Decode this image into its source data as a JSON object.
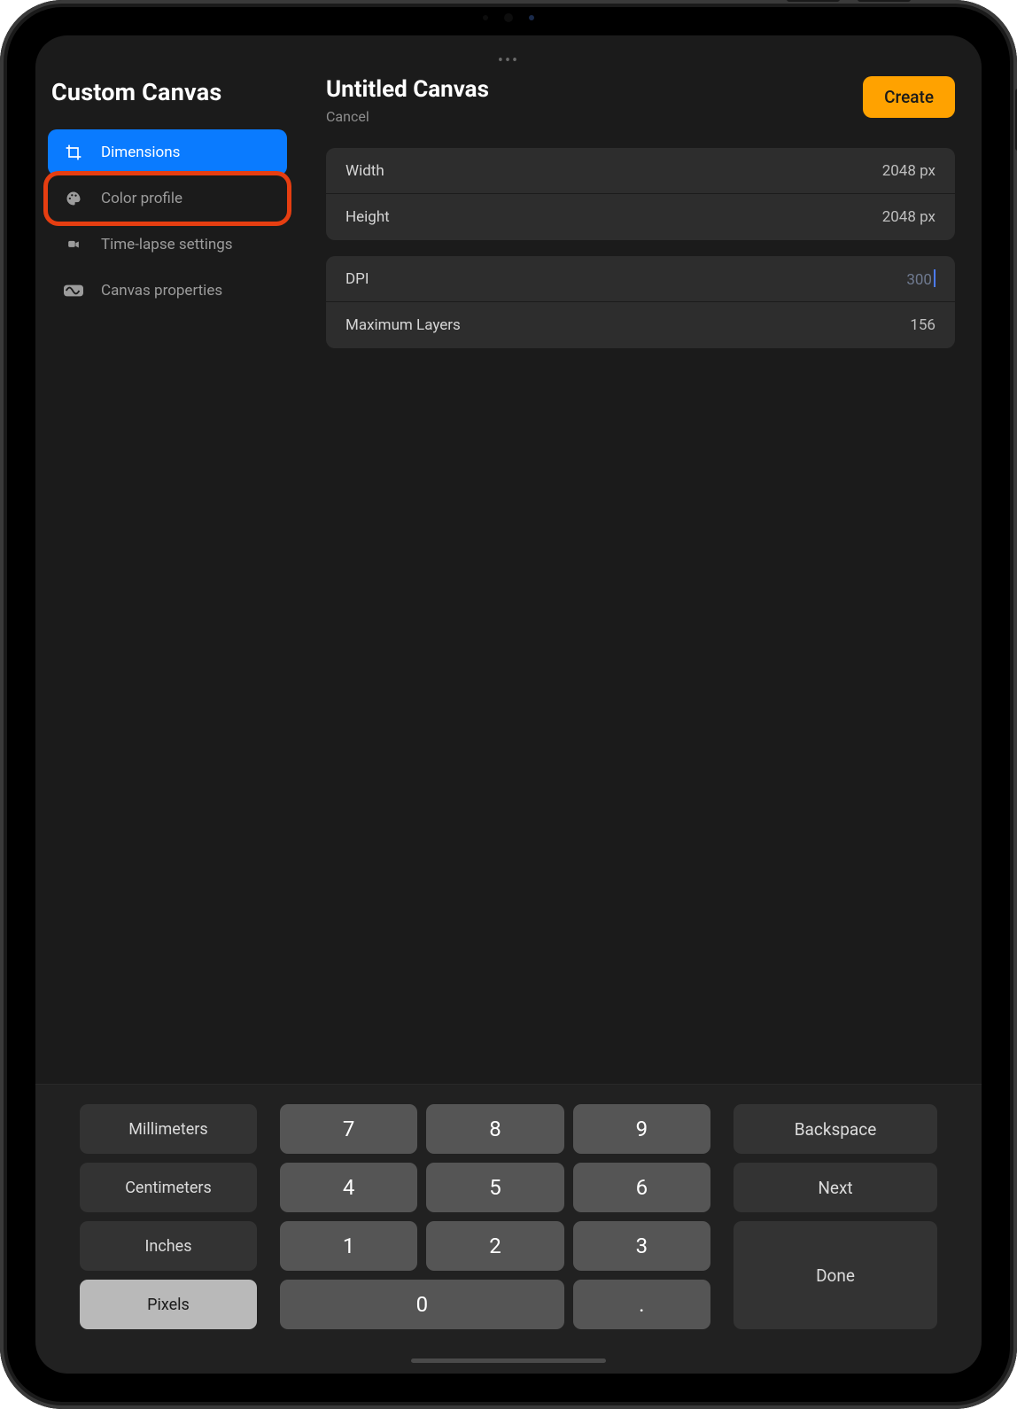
{
  "sidebar": {
    "title": "Custom Canvas",
    "items": [
      {
        "label": "Dimensions",
        "icon": "crop"
      },
      {
        "label": "Color profile",
        "icon": "palette"
      },
      {
        "label": "Time-lapse settings",
        "icon": "video"
      },
      {
        "label": "Canvas properties",
        "icon": "wave"
      }
    ],
    "active_index": 0,
    "highlighted_index": 1
  },
  "header": {
    "title": "Untitled Canvas",
    "cancel": "Cancel",
    "create": "Create"
  },
  "fields": {
    "width": {
      "label": "Width",
      "value": "2048 px"
    },
    "height": {
      "label": "Height",
      "value": "2048 px"
    },
    "dpi": {
      "label": "DPI",
      "value": "300",
      "editing": true
    },
    "layers": {
      "label": "Maximum Layers",
      "value": "156"
    }
  },
  "keypad": {
    "units": [
      "Millimeters",
      "Centimeters",
      "Inches",
      "Pixels"
    ],
    "selected_unit_index": 3,
    "digits": [
      "7",
      "8",
      "9",
      "4",
      "5",
      "6",
      "1",
      "2",
      "3",
      "0",
      "."
    ],
    "actions": {
      "backspace": "Backspace",
      "next": "Next",
      "done": "Done"
    }
  },
  "colors": {
    "accent_blue": "#0a7bff",
    "accent_orange": "#ffa200",
    "highlight_red": "#e63e11"
  }
}
